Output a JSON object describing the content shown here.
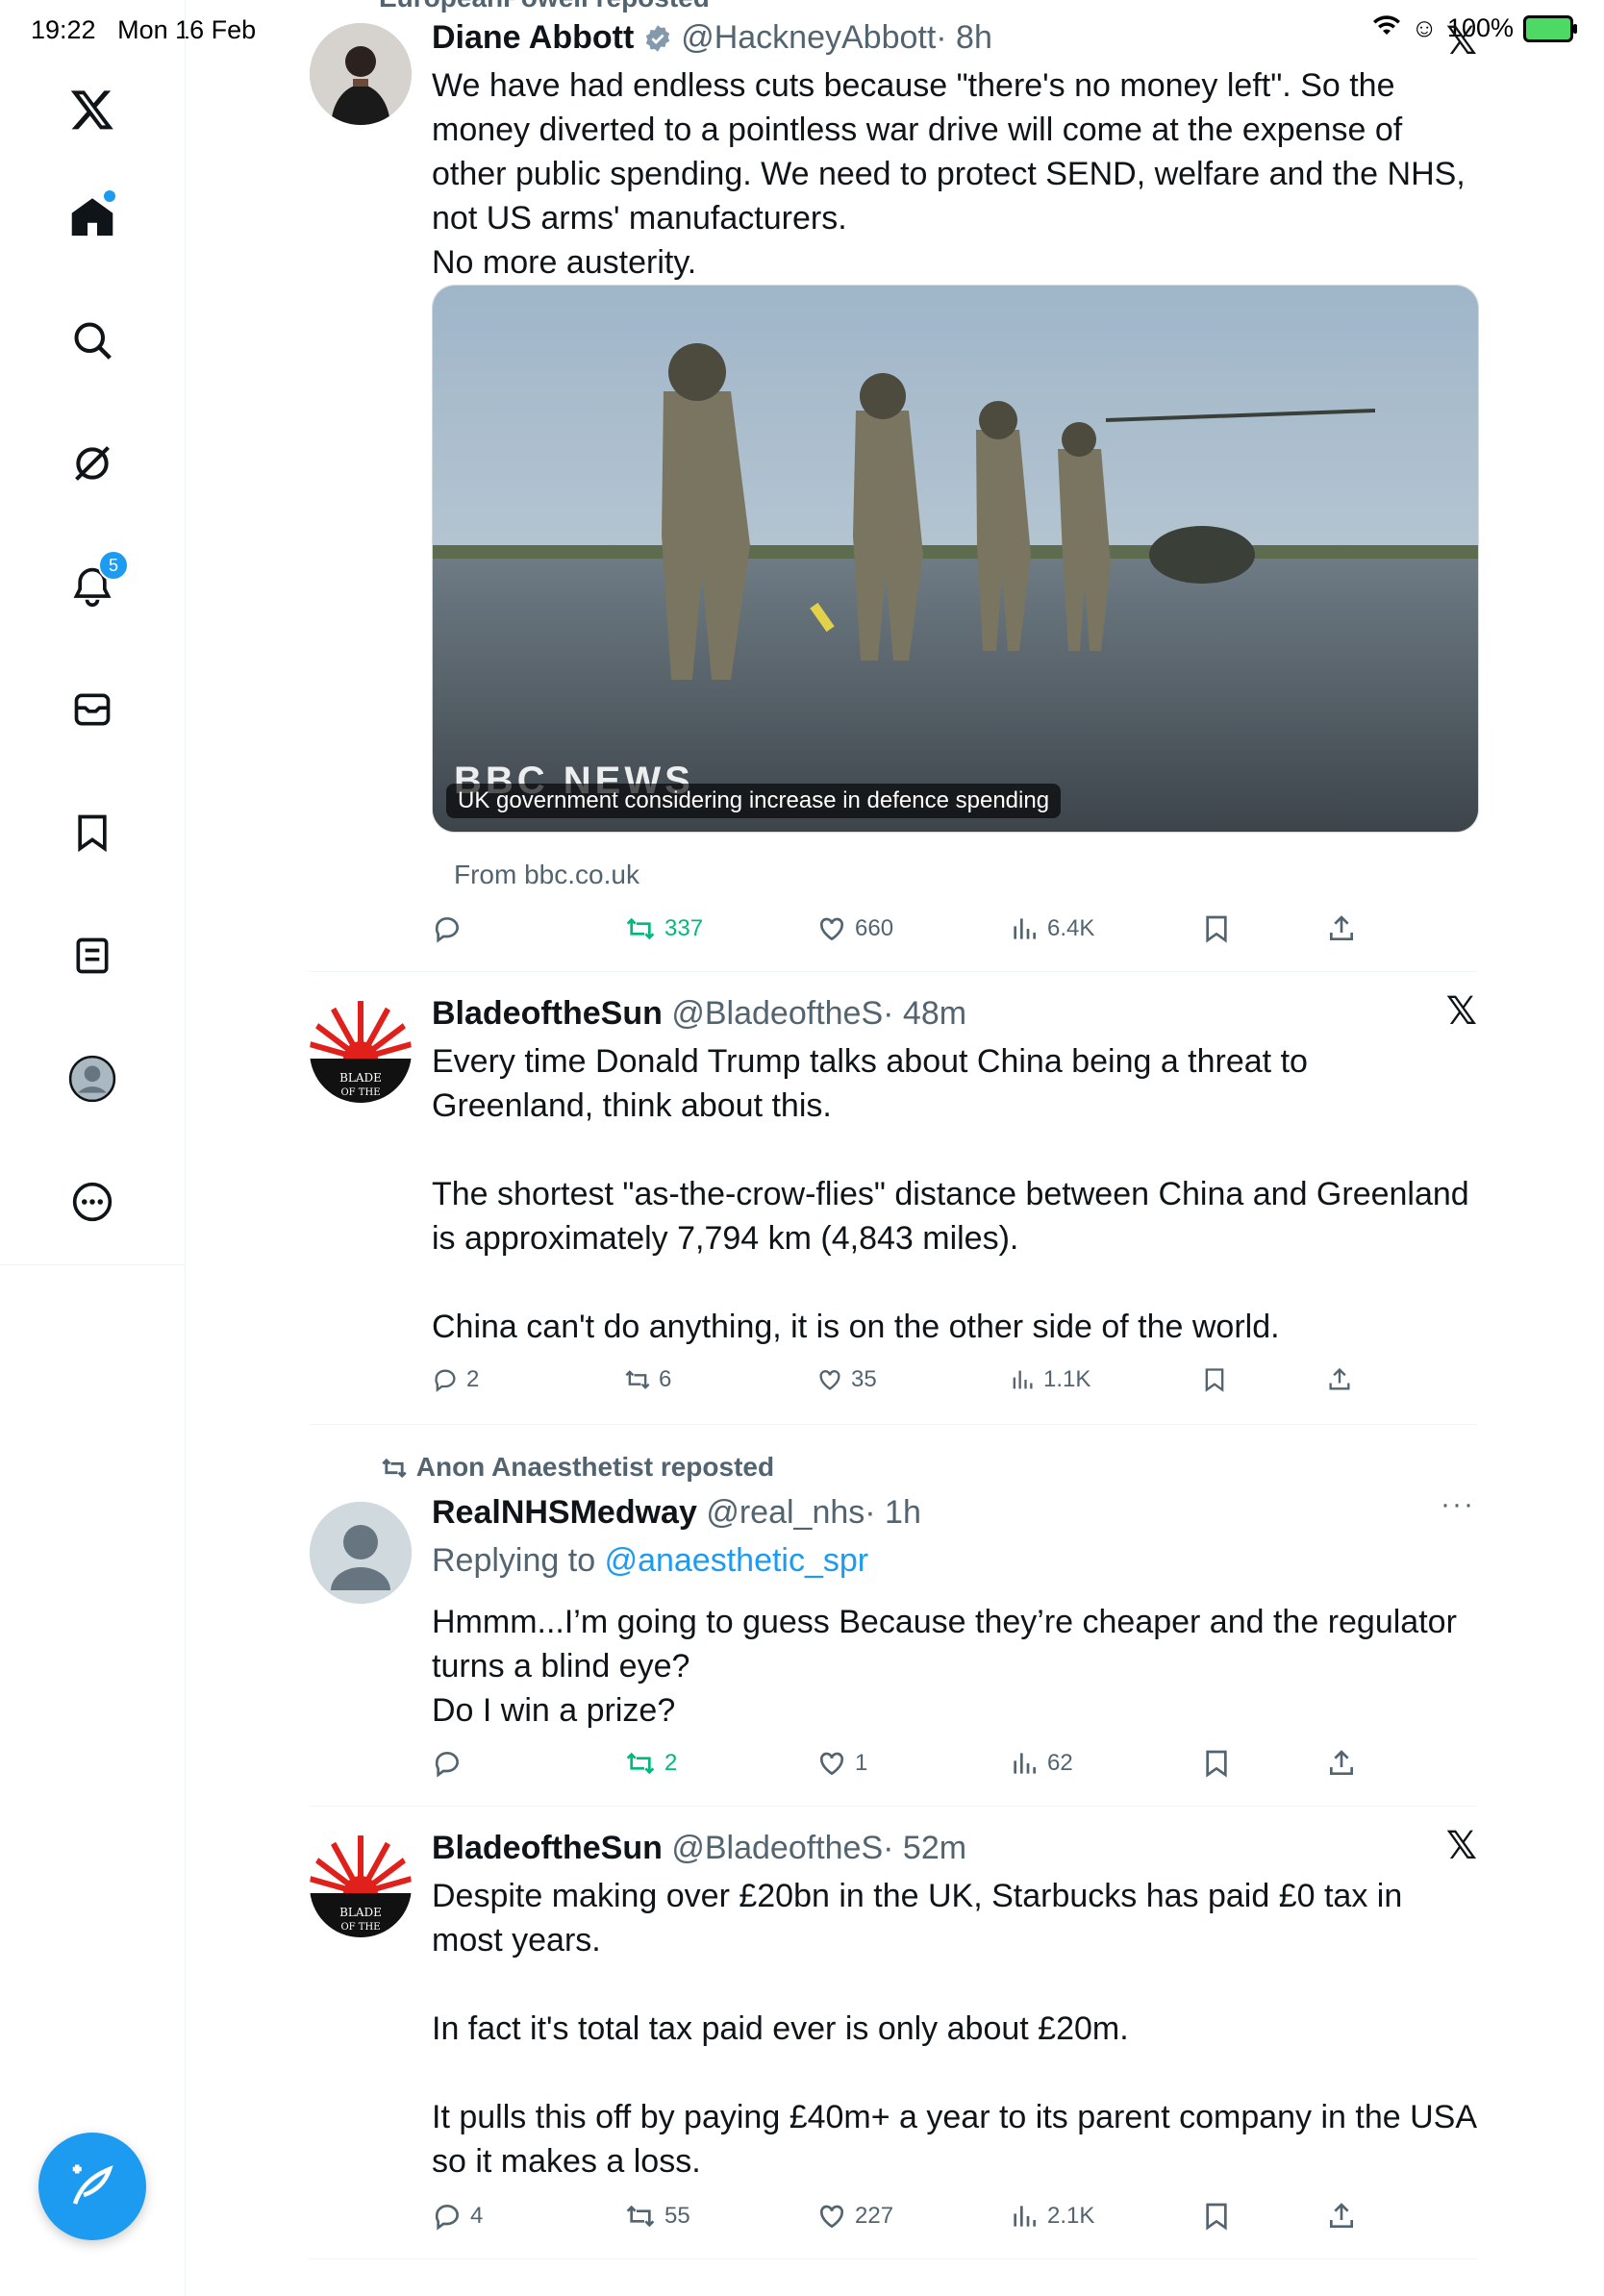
{
  "status_bar": {
    "time": "19:22",
    "date": "Mon 16 Feb",
    "battery": "100%"
  },
  "sidebar": {
    "notification_count": "5",
    "items": [
      "home-icon",
      "search-icon",
      "grok-icon",
      "notifications-icon",
      "messages-icon",
      "bookmarks-icon",
      "lists-icon",
      "profile-icon",
      "more-icon"
    ]
  },
  "feed": {
    "tweet1": {
      "repost_note": "EuropeanPowell reposted",
      "name": "Diane Abbott",
      "handle": "@HackneyAbbott",
      "time": "· 8h",
      "text": "We have had endless cuts because \"there's no money left\". So the money diverted to a pointless war drive will come at the expense of other public spending. We need to protect SEND, welfare and the NHS, not US arms' manufacturers.\nNo more austerity.",
      "card_brand": "BBC NEWS",
      "card_caption": "UK government considering increase in defence spending",
      "card_source": "From bbc.co.uk",
      "replies": "",
      "reposts": "337",
      "likes": "660",
      "views": "6.4K"
    },
    "tweet2": {
      "name": "BladeoftheSun",
      "handle": "@BladeoftheS",
      "time": "· 48m",
      "text": "Every time Donald Trump talks about China being a threat to Greenland, think about this.\n\nThe shortest \"as-the-crow-flies\" distance between China and Greenland is approximately 7,794 km (4,843 miles).\n\nChina can't do anything, it is on the other side of the world.",
      "replies": "2",
      "reposts": "6",
      "likes": "35",
      "views": "1.1K"
    },
    "tweet3": {
      "repost_note": "Anon Anaesthetist reposted",
      "name": "RealNHSMedway",
      "handle": "@real_nhs",
      "time": "· 1h",
      "replying_label": "Replying to",
      "replying_to": "@anaesthetic_spr",
      "text": "Hmmm...I’m going to guess Because they’re cheaper and the regulator turns a blind eye?\nDo I win a prize?",
      "replies": "",
      "reposts": "2",
      "likes": "1",
      "views": "62"
    },
    "tweet4": {
      "name": "BladeoftheSun",
      "handle": "@BladeoftheS",
      "time": "· 52m",
      "text": "Despite making over £20bn in the UK, Starbucks has paid £0 tax in most years.\n\nIn fact it's total tax paid ever is only about £20m.\n\nIt pulls this off by paying £40m+ a year to its parent company in the USA so it makes a loss.",
      "replies": "4",
      "reposts": "55",
      "likes": "227",
      "views": "2.1K"
    }
  }
}
